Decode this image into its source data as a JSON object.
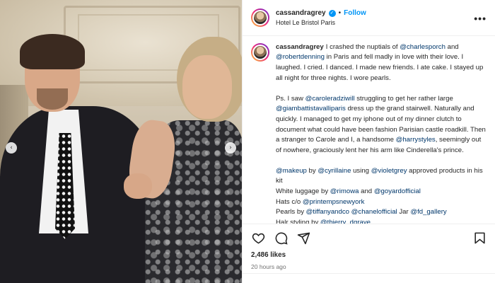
{
  "post": {
    "username": "cassandragrey",
    "follow_label": "Follow",
    "separator": "•",
    "location": "Hotel Le Bristol Paris",
    "more_label": "•••",
    "likes": "2,486 likes",
    "time_ago": "20 hours ago"
  },
  "carousel": {
    "prev_label": "‹",
    "next_label": "›"
  },
  "caption": {
    "p1": [
      {
        "t": "I crashed the nuptials of ",
        "m": false
      },
      {
        "t": "@charlesporch",
        "m": true
      },
      {
        "t": " and ",
        "m": false
      },
      {
        "t": "@robertdenning",
        "m": true
      },
      {
        "t": " in Paris and fell madly in love with their love. I laughed. I cried. I danced. I made new friends. I ate cake. I stayed up all night for three nights. I wore pearls.",
        "m": false
      }
    ],
    "p2": [
      {
        "t": "Ps. I saw ",
        "m": false
      },
      {
        "t": "@caroleradziwill",
        "m": true
      },
      {
        "t": " struggling to get her rather large ",
        "m": false
      },
      {
        "t": "@giambattistavalliparis",
        "m": true
      },
      {
        "t": " dress up the grand stairwell. Naturally and quickly. I managed to get my iphone out of my dinner clutch to document what could have been fashion Parisian castle roadkill. Then a stranger to Carole and I, a handsome ",
        "m": false
      },
      {
        "t": "@harrystyles",
        "m": true
      },
      {
        "t": ", seemingly out of nowhere, graciously lent her his arm like Cinderella's prince.",
        "m": false
      }
    ],
    "credits": [
      [
        {
          "t": "@makeup",
          "m": true
        },
        {
          "t": " by ",
          "m": false
        },
        {
          "t": "@cyrillaine",
          "m": true
        },
        {
          "t": " using ",
          "m": false
        },
        {
          "t": "@violetgrey",
          "m": true
        },
        {
          "t": " approved products in his kit",
          "m": false
        }
      ],
      [
        {
          "t": "White luggage by ",
          "m": false
        },
        {
          "t": "@rimowa",
          "m": true
        },
        {
          "t": " and ",
          "m": false
        },
        {
          "t": "@goyardofficial",
          "m": true
        }
      ],
      [
        {
          "t": "Hats c/o ",
          "m": false
        },
        {
          "t": "@printempsnewyork",
          "m": true
        }
      ],
      [
        {
          "t": "Pearls by ",
          "m": false
        },
        {
          "t": "@tiffanyandco",
          "m": true
        },
        {
          "t": " ",
          "m": false
        },
        {
          "t": "@chanelofficial",
          "m": true
        },
        {
          "t": " Jar ",
          "m": false
        },
        {
          "t": "@fd_gallery",
          "m": true
        }
      ],
      [
        {
          "t": "Halr styling by ",
          "m": false
        },
        {
          "t": "@thierry_dgrave",
          "m": true
        }
      ]
    ]
  },
  "icons": {
    "like": "heart-icon",
    "comment": "comment-icon",
    "share": "share-icon",
    "save": "bookmark-icon",
    "verified": "verified-badge-icon"
  },
  "colors": {
    "accent": "#0095f6",
    "mention": "#00376b",
    "muted": "#737373"
  }
}
